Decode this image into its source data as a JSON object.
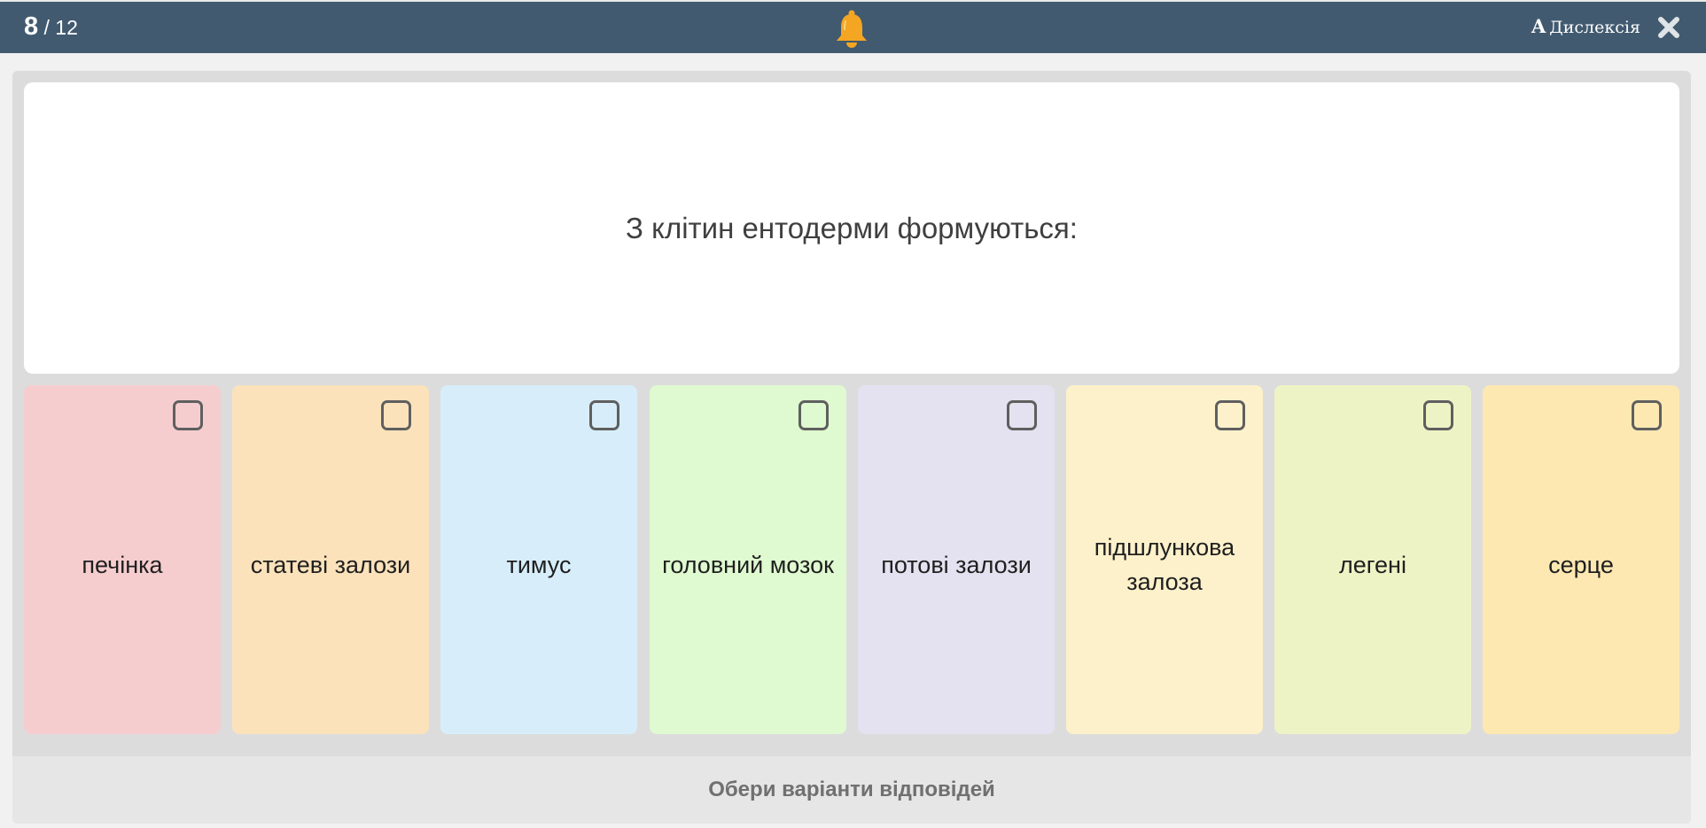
{
  "header": {
    "current_question": "8",
    "total_questions": "/ 12",
    "dyslexia_letter": "A",
    "dyslexia_label": "Дислексія",
    "bell_icon": "bell-icon",
    "close_icon": "close-icon"
  },
  "question": {
    "text": "З клітин ентодерми формуються:"
  },
  "options": [
    {
      "label": "печінка",
      "color": "#f6cdcf"
    },
    {
      "label": "статеві залози",
      "color": "#fbe2bb"
    },
    {
      "label": "тимус",
      "color": "#d7eefa"
    },
    {
      "label": "головний мозок",
      "color": "#dffad0"
    },
    {
      "label": "потові залози",
      "color": "#e4e2f0"
    },
    {
      "label": "підшлункова залоза",
      "color": "#fdf1cb"
    },
    {
      "label": "легені",
      "color": "#eef3c6"
    },
    {
      "label": "серце",
      "color": "#fde8b2"
    }
  ],
  "footer": {
    "prompt": "Обери варіанти відповідей"
  },
  "colors": {
    "topbar": "#415a70",
    "bell": "#f4a623",
    "panel": "#dcdcdc"
  }
}
